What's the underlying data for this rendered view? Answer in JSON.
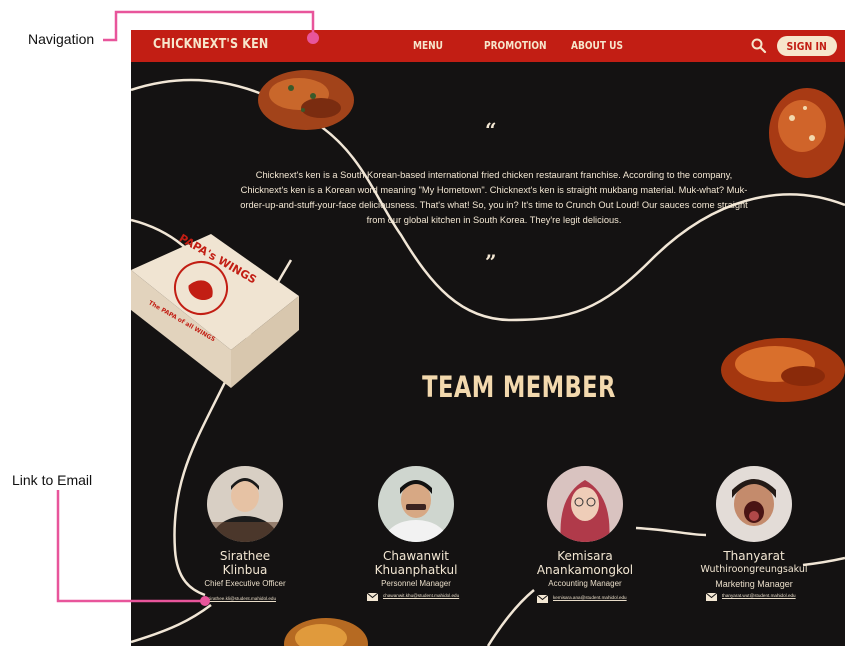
{
  "annotations": {
    "navigation_label": "Navigation",
    "email_link_label": "Link to Email"
  },
  "nav": {
    "brand": "CHICKNEXT'S KEN",
    "links": [
      "MENU",
      "PROMOTION",
      "ABOUT US"
    ],
    "signin_label": "SIGN IN",
    "search_icon": "search-icon"
  },
  "about": {
    "open_quote": "“",
    "close_quote": "”",
    "text": "Chicknext's ken is a South Korean-based international fried chicken restaurant franchise. According to the company, Chicknext's ken is a Korean word meaning \"My Hometown\". Chicknext's ken is straight mukbang material. Muk-what? Muk-order-up-and-stuff-your-face deliciousness. That's what! So, you in? It's time to Crunch Out Loud! Our sauces come straight from our global kitchen in South Korea. They're legit delicious."
  },
  "pizza_box": {
    "brand": "PAPA's WINGS",
    "tagline": "The PAPA of all WINGS"
  },
  "team": {
    "title": "TEAM MEMBER",
    "members": [
      {
        "first": "Sirathee",
        "last": "Klinbua",
        "role": "Chief Executive Officer",
        "email": "sirathee.kli@student.mahidol.edu"
      },
      {
        "first": "Chawanwit",
        "last": "Khuanphatkul",
        "role": "Personnel Manager",
        "email": "chawanwit.khu@student.mahidol.edu"
      },
      {
        "first": "Kemisara",
        "last": "Anankamongkol",
        "role": "Accounting Manager",
        "email": "kemisara.ana@student.mahidol.edu"
      },
      {
        "first": "Thanyarat",
        "last": "Wuthiroongreungsakul",
        "role": "Marketing Manager",
        "email": "thanyarat.wut@student.mahidol.edu"
      }
    ]
  },
  "colors": {
    "nav_red": "#c21e14",
    "cream": "#f7e6cc",
    "background": "#141212",
    "annotation_pink": "#e8559b"
  }
}
